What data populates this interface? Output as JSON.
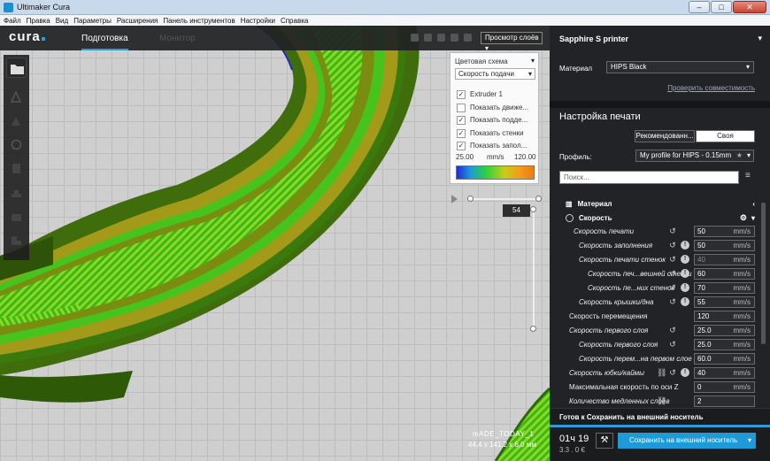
{
  "window": {
    "title": "Ultimaker Cura",
    "minimize": "–",
    "maximize": "□",
    "close": "✕"
  },
  "menu": [
    "Файл",
    "Правка",
    "Вид",
    "Параметры",
    "Расширения",
    "Панель инструментов",
    "Настройки",
    "Справка"
  ],
  "header": {
    "logo": "cura",
    "stage_prepare": "Подготовка",
    "stage_monitor": "Монитор",
    "view_select": "Просмотр слоёв"
  },
  "color_scheme": {
    "title": "Цветовая схема",
    "selected": "Скорость подачи",
    "options": [
      {
        "label": "Extruder 1",
        "checked": true
      },
      {
        "label": "Показать движе...",
        "checked": false
      },
      {
        "label": "Показать подде...",
        "checked": true
      },
      {
        "label": "Показать стенки",
        "checked": true
      },
      {
        "label": "Показать запол...",
        "checked": true
      }
    ],
    "scale_min": "25.00",
    "scale_unit": "mm/s",
    "scale_max": "120.00"
  },
  "layer_view": {
    "current_layer": "54"
  },
  "model": {
    "name": "mADE_TODAY_1",
    "dimensions": "44,4 x 141,2 x 6,0 мм"
  },
  "panel": {
    "printer": "Sapphire S printer",
    "material_label": "Материал",
    "material_value": "HIPS Black",
    "compat_link": "Проверить совместимость",
    "settings_title": "Настройка печати",
    "mode_recommended": "Рекомендованн...",
    "mode_custom": "Своя",
    "profile_label": "Профиль:",
    "profile_value": "My profile for HIPS - 0.15mm",
    "search_placeholder": "Поиск...",
    "categories": {
      "material": "Материал",
      "speed": "Скорость"
    },
    "rows": [
      {
        "label": "Скорость печати",
        "value": "50",
        "unit": "mm/s",
        "reset": true,
        "info": false,
        "link": false
      },
      {
        "label": "Скорость заполнения",
        "value": "50",
        "unit": "mm/s",
        "reset": true,
        "info": true,
        "link": false
      },
      {
        "label": "Скорость печати стенок",
        "value": "40",
        "unit": "mm/s",
        "reset": true,
        "info": true,
        "link": false
      },
      {
        "label": "Скорость печ...вешней стенки",
        "value": "60",
        "unit": "mm/s",
        "reset": true,
        "info": true,
        "link": false
      },
      {
        "label": "Скорость пе...них стенок",
        "value": "70",
        "unit": "mm/s",
        "reset": true,
        "info": true,
        "link": false
      },
      {
        "label": "Скорость крышки/дна",
        "value": "55",
        "unit": "mm/s",
        "reset": true,
        "info": true,
        "link": false
      },
      {
        "label": "Скорость перемещения",
        "value": "120",
        "unit": "mm/s",
        "reset": false,
        "info": false,
        "link": false
      },
      {
        "label": "Скорость первого слоя",
        "value": "25.0",
        "unit": "mm/s",
        "reset": true,
        "info": false,
        "link": false
      },
      {
        "label": "Скорость первого слоя",
        "value": "25.0",
        "unit": "mm/s",
        "reset": true,
        "info": false,
        "link": false
      },
      {
        "label": "Скорость перем...на первом слое",
        "value": "60.0",
        "unit": "mm/s",
        "reset": false,
        "info": false,
        "link": false
      },
      {
        "label": "Скорость юбки/каймы",
        "value": "40",
        "unit": "mm/s",
        "reset": true,
        "info": true,
        "link": true
      },
      {
        "label": "Максимальная скорость по оси Z",
        "value": "0",
        "unit": "mm/s",
        "reset": false,
        "info": false,
        "link": false
      },
      {
        "label": "Количество медленных слоёв",
        "value": "2",
        "unit": "",
        "reset": false,
        "info": false,
        "link": true
      }
    ],
    "footer": {
      "status": "Готов к Сохранить на внешний носитель",
      "time": "01ч 19",
      "cost": "3.3 . 0 €",
      "save_button": "Сохранить на внешний носитель"
    }
  },
  "colors": {
    "accent": "#1e9ad8",
    "panel_bg": "#212326",
    "print_green": "#3ac21a"
  }
}
